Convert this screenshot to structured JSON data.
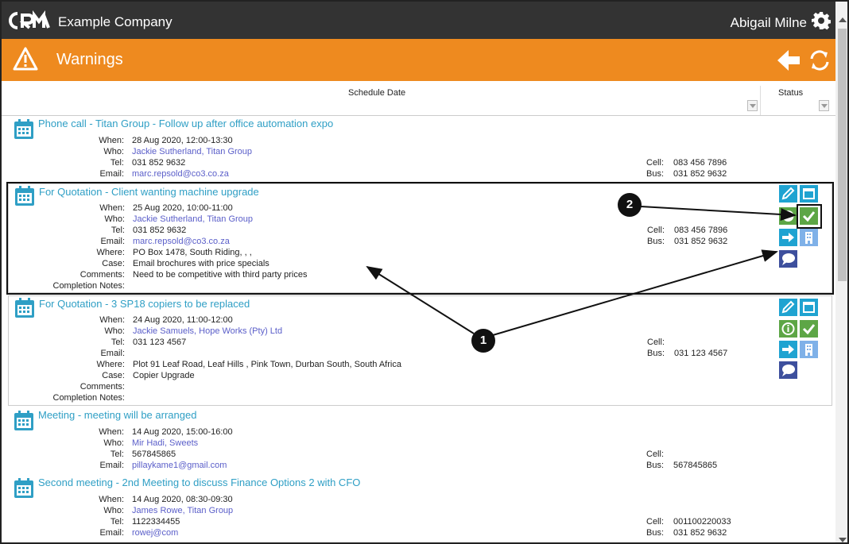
{
  "app": {
    "company": "Example Company",
    "user": "Abigail Milne"
  },
  "page": {
    "title": "Warnings"
  },
  "columns": {
    "schedule_date": "Schedule Date",
    "status": "Status"
  },
  "labels": {
    "when": "When:",
    "who": "Who:",
    "tel": "Tel:",
    "email": "Email:",
    "where": "Where:",
    "case": "Case:",
    "comments": "Comments:",
    "completion_notes": "Completion Notes:",
    "cell": "Cell:",
    "bus": "Bus:"
  },
  "tasks": [
    {
      "title": "Phone call - Titan Group - Follow up after office automation expo",
      "when": "28 Aug 2020, 12:00-13:30",
      "who": "Jackie Sutherland, Titan Group",
      "tel": "031 852 9632",
      "email": "marc.repsold@co3.co.za",
      "cell": "083 456 7896",
      "bus": "031 852 9632"
    },
    {
      "title": "For Quotation - Client wanting machine upgrade",
      "when": "25 Aug 2020, 10:00-11:00",
      "who": "Jackie Sutherland, Titan Group",
      "tel": "031 852 9632",
      "email": "marc.repsold@co3.co.za",
      "where": "PO Box 1478, South Riding, , ,",
      "case": "Email brochures with price specials",
      "comments": "Need to be competitive with third party prices",
      "completion_notes": "",
      "cell": "083 456 7896",
      "bus": "031 852 9632"
    },
    {
      "title": "For Quotation - 3 SP18 copiers to be replaced",
      "when": "24 Aug 2020, 11:00-12:00",
      "who": "Jackie Samuels, Hope Works (Pty) Ltd",
      "tel": "031 123 4567",
      "email": "",
      "where": "Plot 91 Leaf Road, Leaf Hills , Pink Town, Durban South, South Africa",
      "case": "Copier Upgrade",
      "comments": "",
      "completion_notes": "",
      "cell": "",
      "bus": "031 123 4567"
    },
    {
      "title": "Meeting - meeting will be arranged",
      "when": "14 Aug 2020, 15:00-16:00",
      "who": "Mir Hadi, Sweets",
      "tel": "567845865",
      "email": "pillaykame1@gmail.com",
      "cell": "",
      "bus": "567845865"
    },
    {
      "title": "Second meeting - 2nd Meeting to discuss Finance Options 2 with CFO",
      "when": "14 Aug 2020, 08:30-09:30",
      "who": "James Rowe, Titan Group",
      "tel": "1122334455",
      "email": "rowej@com",
      "cell": "001100220033",
      "bus": "031 852 9632"
    }
  ],
  "annotations": {
    "callout_1": "1",
    "callout_2": "2"
  },
  "colors": {
    "header_bg": "#333333",
    "accent_orange": "#ee8a1f",
    "link_teal": "#2f9fc5",
    "link_purple": "#5a5ec9",
    "action_teal": "#1fa3d1",
    "action_green": "#5da646",
    "action_navy": "#3d4f9d",
    "action_light_blue": "#7fb1e8"
  },
  "icons": [
    "crm-logo",
    "gear-icon",
    "warning-icon",
    "back-arrow-icon",
    "refresh-icon",
    "calendar-icon",
    "edit-icon",
    "schedule-icon",
    "info-icon",
    "complete-check-icon",
    "forward-icon",
    "building-icon",
    "comment-icon"
  ]
}
